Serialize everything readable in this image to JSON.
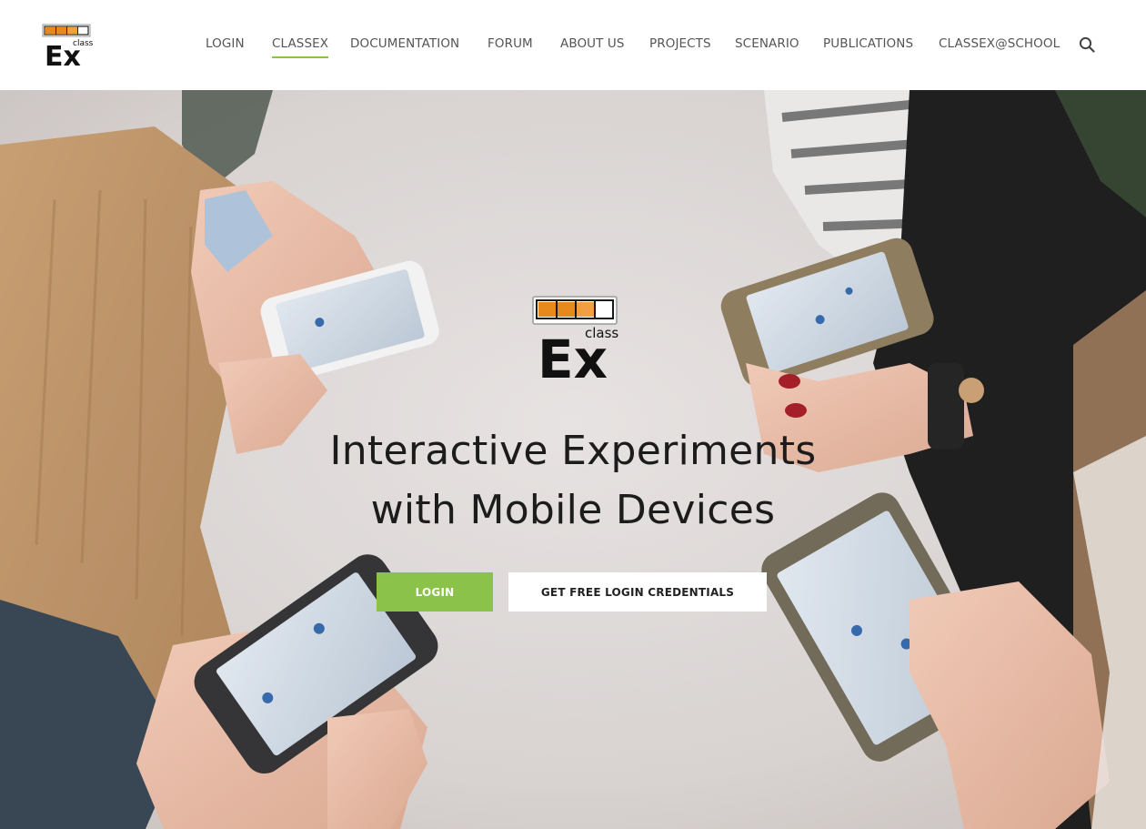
{
  "header": {
    "logo_text": "Ex",
    "logo_sub": "class",
    "nav": [
      {
        "label": "LOGIN"
      },
      {
        "label": "CLASSEX"
      },
      {
        "label": "DOCUMENTATION"
      },
      {
        "label": "FORUM"
      },
      {
        "label": "ABOUT US"
      },
      {
        "label": "PROJECTS"
      },
      {
        "label": "SCENARIO"
      },
      {
        "label": "PUBLICATIONS"
      },
      {
        "label": "CLASSEX@SCHOOL"
      }
    ],
    "active_item": "CLASSEX",
    "search_icon": "search-icon"
  },
  "hero": {
    "logo_text": "Ex",
    "logo_sub": "class",
    "headline_line1": "Interactive Experiments",
    "headline_line2": "with Mobile Devices",
    "login_button": "LOGIN",
    "credentials_button": "GET FREE LOGIN CREDENTIALS",
    "background_image": "photo of hands holding smartphones"
  },
  "colors": {
    "accent": "#8bc34a",
    "logo_orange": "#e8891c",
    "text_dark": "#1c1c1c",
    "nav_text": "#555555"
  }
}
